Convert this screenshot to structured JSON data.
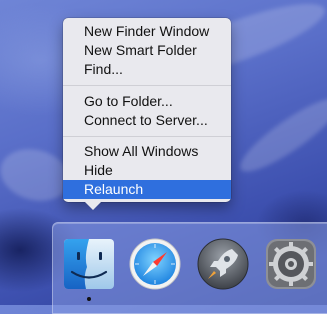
{
  "context_menu": {
    "items": [
      {
        "label": "New Finder Window"
      },
      {
        "label": "New Smart Folder"
      },
      {
        "label": "Find..."
      },
      {
        "label": "Go to Folder..."
      },
      {
        "label": "Connect to Server..."
      },
      {
        "label": "Show All Windows"
      },
      {
        "label": "Hide"
      },
      {
        "label": "Relaunch"
      }
    ],
    "highlighted": "Relaunch"
  },
  "dock": {
    "apps": [
      {
        "name": "finder-icon",
        "running": true
      },
      {
        "name": "safari-icon",
        "running": false
      },
      {
        "name": "launchpad-icon",
        "running": false
      },
      {
        "name": "system-preferences-icon",
        "running": false
      }
    ]
  },
  "colors": {
    "menu_background": "#e9e9ee",
    "selection": "#2f6fde",
    "desktop": "#4a5fc0"
  }
}
